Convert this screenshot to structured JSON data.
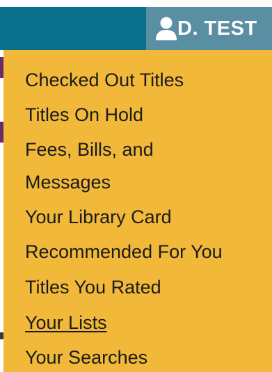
{
  "header": {
    "user_label": "D. TEST",
    "bar_color": "#0a6f8a",
    "user_button_color": "#5a8ea3",
    "user_icon": "user-icon"
  },
  "dropdown": {
    "background_color": "#f1b839",
    "items": [
      {
        "label": "Checked Out Titles"
      },
      {
        "label": "Titles On Hold"
      },
      {
        "label": "Fees, Bills, and"
      },
      {
        "label": "Messages"
      },
      {
        "label": "Your Library Card"
      },
      {
        "label": "Recommended For You"
      },
      {
        "label": "Titles You Rated"
      },
      {
        "label": "Your Lists"
      },
      {
        "label": "Your Searches"
      }
    ]
  }
}
